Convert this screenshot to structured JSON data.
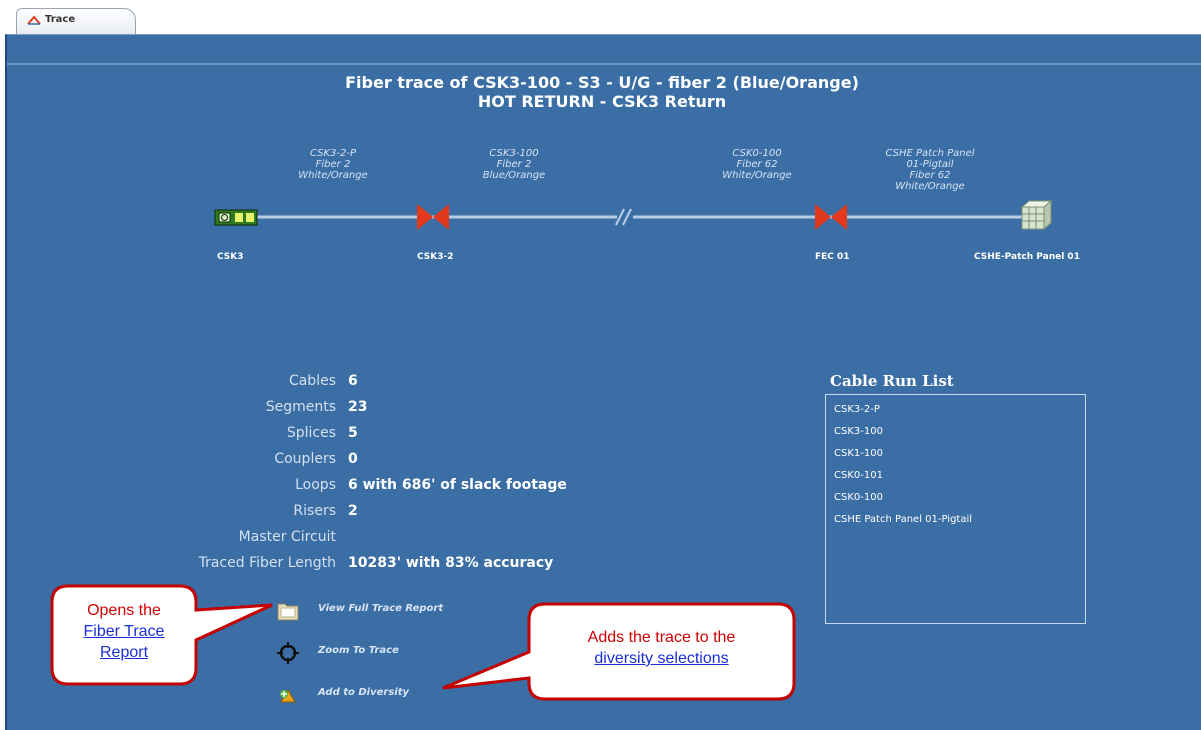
{
  "tab": {
    "label": "Trace",
    "icon": "trace-icon"
  },
  "title": {
    "line1": "Fiber trace of CSK3-100 - S3 - U/G - fiber 2 (Blue/Orange)",
    "line2": "HOT RETURN - CSK3 Return"
  },
  "trace": {
    "top_labels": [
      {
        "lines": [
          "CSK3-2-P",
          "Fiber 2",
          "White/Orange"
        ]
      },
      {
        "lines": [
          "CSK3-100",
          "Fiber 2",
          "Blue/Orange"
        ]
      },
      {
        "lines": [
          "CSK0-100",
          "Fiber 62",
          "White/Orange"
        ]
      },
      {
        "lines": [
          "CSHE Patch Panel",
          "01-Pigtail",
          "Fiber 62",
          "White/Orange"
        ]
      }
    ],
    "nodes": [
      {
        "label": "CSK3",
        "icon": "equipment-icon"
      },
      {
        "label": "CSK3-2",
        "icon": "splice-icon"
      },
      {
        "label": "FEC 01",
        "icon": "splice-icon"
      },
      {
        "label": "CSHE-Patch Panel 01",
        "icon": "patch-panel-icon"
      }
    ]
  },
  "stats": [
    {
      "label": "Cables",
      "value": "6"
    },
    {
      "label": "Segments",
      "value": "23"
    },
    {
      "label": "Splices",
      "value": "5"
    },
    {
      "label": "Couplers",
      "value": "0"
    },
    {
      "label": "Loops",
      "value": "6 with 686' of slack footage"
    },
    {
      "label": "Risers",
      "value": "2"
    },
    {
      "label": "Master Circuit",
      "value": ""
    },
    {
      "label": "Traced Fiber Length",
      "value": "10283' with 83% accuracy"
    }
  ],
  "cable_run_list": {
    "title": "Cable Run List",
    "items": [
      "CSK3-2-P",
      "CSK3-100",
      "CSK1-100",
      "CSK0-101",
      "CSK0-100",
      "CSHE Patch Panel 01-Pigtail"
    ]
  },
  "actions": [
    {
      "label": "View Full Trace Report",
      "icon": "folder-icon"
    },
    {
      "label": "Zoom To Trace",
      "icon": "crosshair-icon"
    },
    {
      "label": "Add to Diversity",
      "icon": "add-diversity-icon"
    }
  ],
  "callouts": {
    "left": {
      "prefix": "Opens the",
      "link": "Fiber Trace Report"
    },
    "right": {
      "prefix": "Adds the trace to the",
      "link": "diversity selections"
    }
  },
  "colors": {
    "panel_bg": "#3b6ea5",
    "trace_line": "#b9cde6",
    "splice": "#e2391e",
    "callout_text": "#d00000",
    "callout_link": "#1a2fd6"
  }
}
